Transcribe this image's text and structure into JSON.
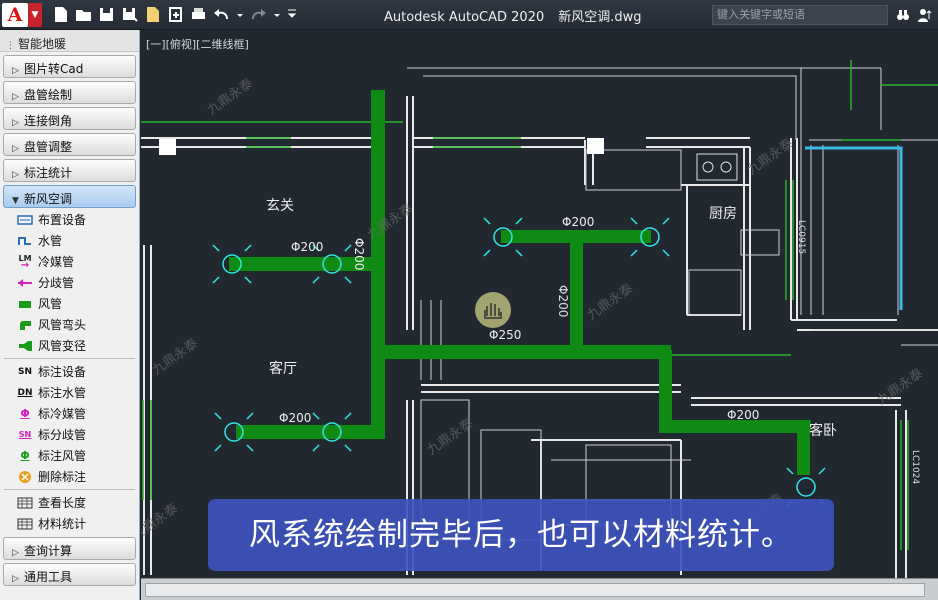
{
  "window": {
    "app_title": "Autodesk AutoCAD 2020",
    "file_name": "新风空调.dwg",
    "app_button_letter": "A",
    "search_placeholder": "键入关键字或短语"
  },
  "sidebar": {
    "header": "智能地暖",
    "categories_top": [
      {
        "label": "图片转Cad"
      },
      {
        "label": "盘管绘制"
      },
      {
        "label": "连接倒角"
      },
      {
        "label": "盘管调整"
      },
      {
        "label": "标注统计"
      }
    ],
    "open_category": {
      "label": "新风空调"
    },
    "items_group1": [
      {
        "label": "布置设备",
        "icon": "equipment-icon"
      },
      {
        "label": "水管",
        "icon": "water-pipe-icon"
      },
      {
        "label": "冷媒管",
        "icon": "refrigerant-pipe-icon",
        "icon_text": "LM"
      },
      {
        "label": "分歧管",
        "icon": "branch-pipe-icon"
      },
      {
        "label": "风管",
        "icon": "air-duct-icon"
      },
      {
        "label": "风管弯头",
        "icon": "duct-elbow-icon"
      },
      {
        "label": "风管变径",
        "icon": "duct-reducer-icon"
      }
    ],
    "items_group2": [
      {
        "label": "标注设备",
        "icon": "label-equipment-icon",
        "icon_text": "SN"
      },
      {
        "label": "标注水管",
        "icon": "label-water-pipe-icon",
        "icon_text": "DN"
      },
      {
        "label": "标冷媒管",
        "icon": "label-refrigerant-icon",
        "icon_text": "Φ"
      },
      {
        "label": "标分歧管",
        "icon": "label-branch-icon",
        "icon_text": "SN"
      },
      {
        "label": "标注风管",
        "icon": "label-duct-icon",
        "icon_text": "Φ"
      },
      {
        "label": "删除标注",
        "icon": "delete-label-icon"
      }
    ],
    "items_group3": [
      {
        "label": "查看长度",
        "icon": "length-icon"
      },
      {
        "label": "材料统计",
        "icon": "material-stats-icon"
      }
    ],
    "categories_bottom": [
      {
        "label": "查询计算"
      },
      {
        "label": "通用工具"
      }
    ]
  },
  "viewport": {
    "label": "[一][俯视][二维线框]",
    "rooms": [
      "玄关",
      "客厅",
      "厨房",
      "客卧"
    ],
    "duct_sizes": [
      "Φ200",
      "Φ200",
      "Φ200",
      "Φ250",
      "Φ200",
      "Φ200",
      "Φ200"
    ],
    "vertical_labels": [
      "LC0915",
      "LC1024",
      "Φ200"
    ],
    "watermark": "九鼎永泰",
    "colors": {
      "duct": "#0f8a12",
      "wall": "#ffffff",
      "diffuser": "#33e6e6",
      "background": "#212830"
    }
  },
  "subtitle": "风系统绘制完毕后，也可以材料统计。"
}
